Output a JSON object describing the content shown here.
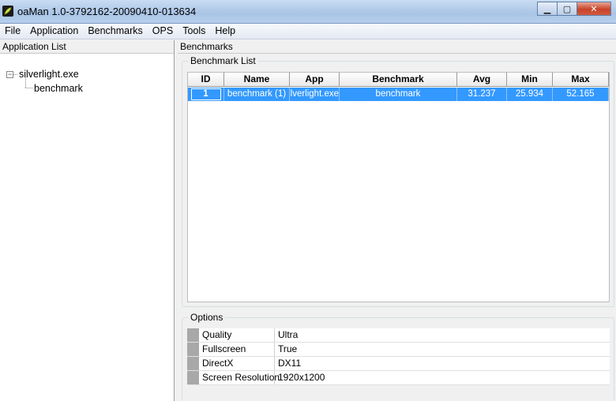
{
  "window": {
    "title": "oaMan 1.0-3792162-20090410-013634",
    "controls": {
      "minimize": "▁",
      "maximize": "▢",
      "close": "✕"
    }
  },
  "menu": [
    "File",
    "Application",
    "Benchmarks",
    "OPS",
    "Tools",
    "Help"
  ],
  "left": {
    "header": "Application List",
    "tree": {
      "expander": "−",
      "root": "silverlight.exe",
      "child": "benchmark"
    }
  },
  "right": {
    "header": "Benchmarks",
    "benchmark_group": "Benchmark List",
    "columns": [
      "ID",
      "Name",
      "App",
      "Benchmark",
      "Avg",
      "Min",
      "Max"
    ],
    "rows": [
      {
        "id": "1",
        "name": "benchmark (1)",
        "app": "silverlight.exe",
        "benchmark": "benchmark",
        "avg": "31.237",
        "min": "25.934",
        "max": "52.165"
      }
    ],
    "options_group": "Options",
    "options": [
      {
        "name": "Quality",
        "value": "Ultra"
      },
      {
        "name": "Fullscreen",
        "value": "True"
      },
      {
        "name": "DirectX",
        "value": "DX11"
      },
      {
        "name": "Screen Resolution",
        "value": "1920x1200"
      }
    ]
  },
  "colors": {
    "selection": "#3399ff",
    "titlebar": "#b7cfee"
  }
}
